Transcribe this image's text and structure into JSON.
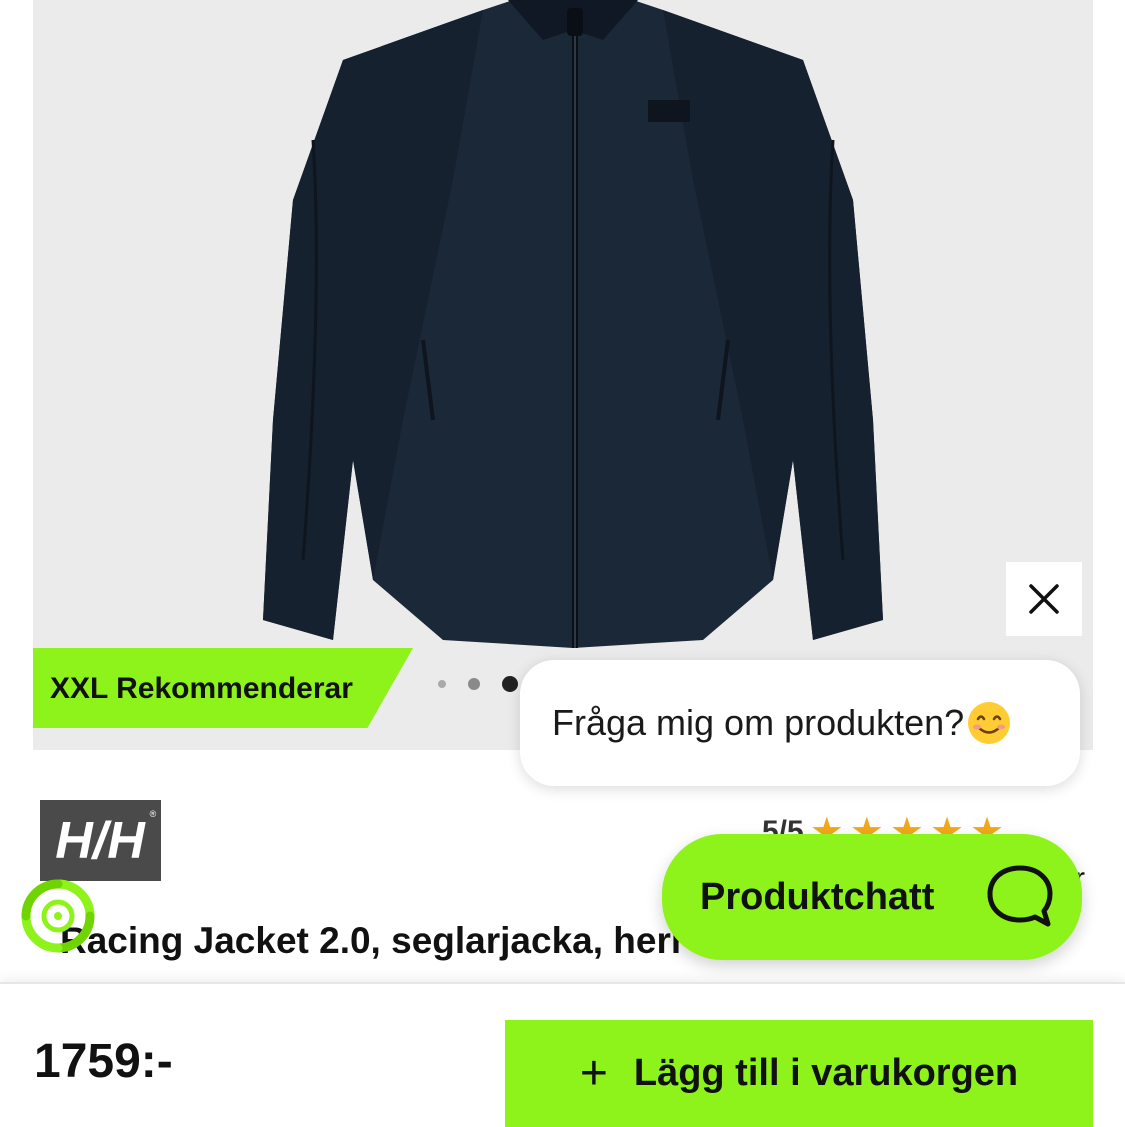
{
  "gallery": {
    "badge_label": "XXL Rekommenderar",
    "dots": 4,
    "active_dot": 3
  },
  "chat_popup": {
    "prompt": "Fråga mig om produkten?",
    "emoji": "smiling-face-icon"
  },
  "product": {
    "brand_logo": "HH",
    "rating": "5/5",
    "stars": 5,
    "reviews_fragment": "r",
    "title": "Racing Jacket 2.0, seglarjacka, herr"
  },
  "chat_button": {
    "label": "Produktchatt"
  },
  "purchase": {
    "price": "1759:-",
    "add_to_cart_label": "Lägg till i varukorgen"
  },
  "colors": {
    "accent": "#8ef31a",
    "star": "#f3a81a",
    "jacket": "#1b2838"
  }
}
